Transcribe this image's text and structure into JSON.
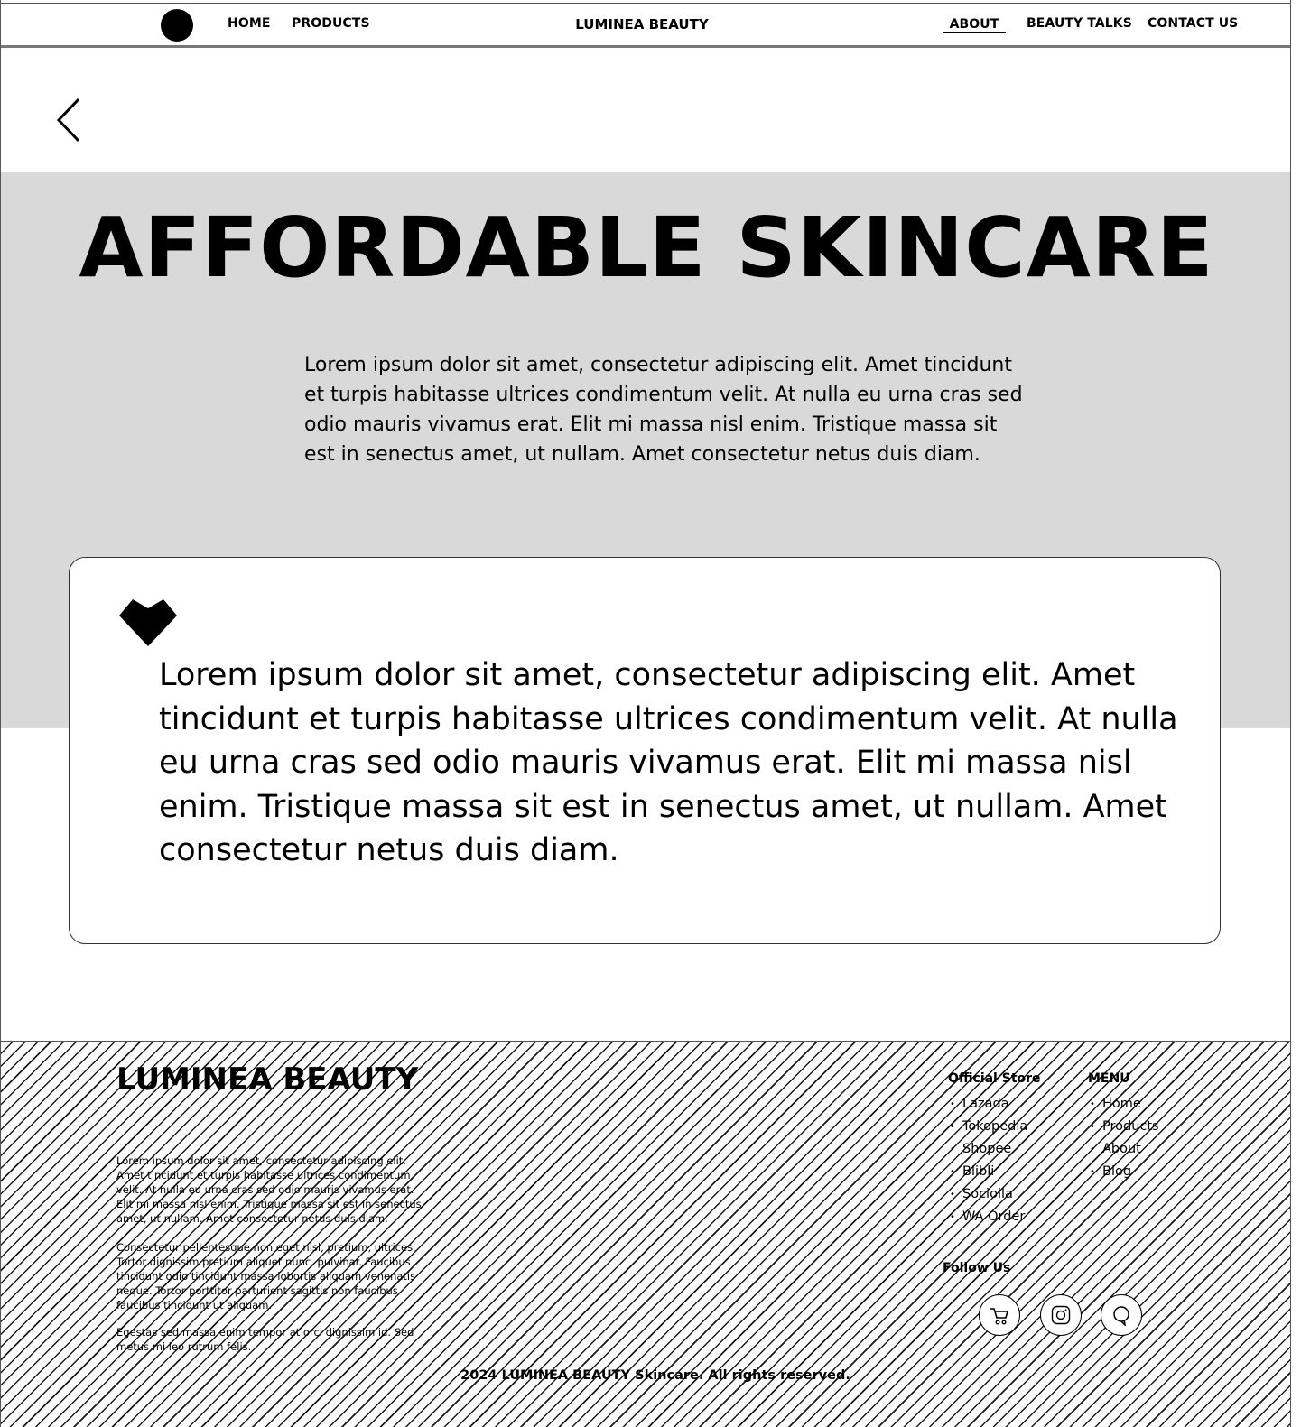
{
  "nav": {
    "home": "HOME",
    "products": "PRODUCTS",
    "brand": "LUMINEA BEAUTY",
    "about": "ABOUT",
    "beauty_talks": "BEAUTY TALKS",
    "contact": "CONTACT US"
  },
  "hero": {
    "title": "AFFORDABLE SKINCARE",
    "text": "Lorem ipsum dolor sit amet, consectetur adipiscing elit. Amet tincidunt et turpis habitasse ultrices condimentum velit. At nulla eu urna cras sed odio mauris vivamus erat. Elit mi massa nisl enim. Tristique massa sit est in senectus amet, ut nullam. Amet consectetur netus duis diam."
  },
  "card": {
    "icon": "heart-icon",
    "text": "Lorem ipsum dolor sit amet, consectetur adipiscing elit. Amet tincidunt et turpis habitasse ultrices condimentum velit. At nulla eu urna cras sed odio mauris vivamus erat. Elit mi massa nisl enim. Tristique massa sit est in senectus amet, ut nullam. Amet consectetur netus duis diam."
  },
  "footer": {
    "brand": "LUMINEA BEAUTY",
    "paragraphs": [
      "Lorem ipsum dolor sit amet, consectetur adipiscing elit. Amet tincidunt et turpis habitasse ultrices condimentum velit. At nulla eu urna cras sed odio mauris vivamus erat. Elit mi massa nisl enim. Tristique massa sit est in senectus amet, ut nullam. Amet consectetur netus duis diam.",
      "Consectetur pellentesque non eget nisl, pretium, ultrices. Tortor dignissim pretium aliquet nunc, pulvinar. Faucibus tincidunt odio tincidunt massa lobortis aliquam venenatis neque. Tortor porttitor parturient sagittis non faucibus faucibus tincidunt ut aliquam.",
      "Egestas sed massa enim tempor at orci dignissim id. Sed metus mi leo rutrum felis."
    ],
    "official_store": {
      "title": "Official Store",
      "items": [
        "Lazada",
        "Tokopedia",
        "Shopee",
        "Blibli",
        "Sociolla",
        "WA Order"
      ]
    },
    "menu": {
      "title": "MENU",
      "items": [
        "Home",
        "Products",
        "About",
        "Blog"
      ]
    },
    "follow_us": "Follow Us",
    "social_icons": [
      "shopping-cart-icon",
      "instagram-icon",
      "chat-icon"
    ],
    "copyright": "2024 LUMINEA BEAUTY Skincare. All rights reserved."
  }
}
